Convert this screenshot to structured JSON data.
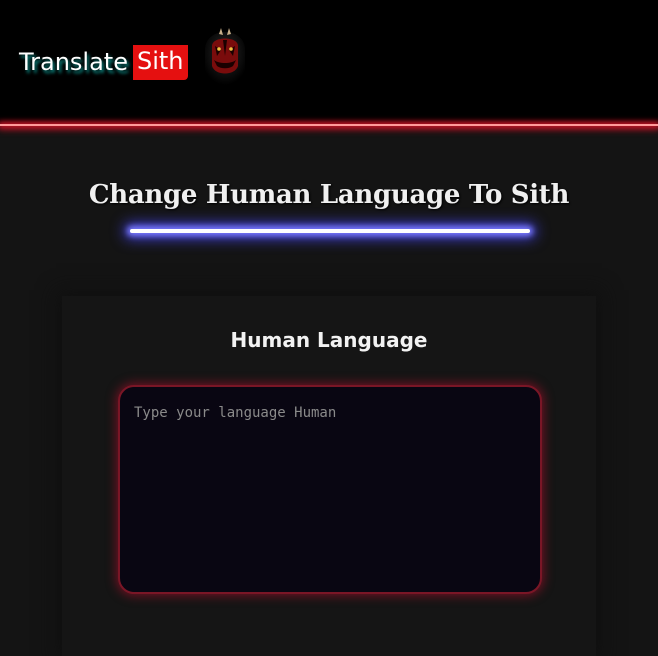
{
  "header": {
    "brand_word": "Translate",
    "brand_highlight": "Sith",
    "logo_icon": "sith-face-icon"
  },
  "main": {
    "title": "Change Human Language To Sith",
    "input_label": "Human Language",
    "input_placeholder": "Type your language Human",
    "input_value": ""
  },
  "colors": {
    "background": "#141414",
    "header": "#000000",
    "accent_red": "#e51010",
    "saber_glow": "#7a7aff",
    "input_border": "#7a1626"
  }
}
